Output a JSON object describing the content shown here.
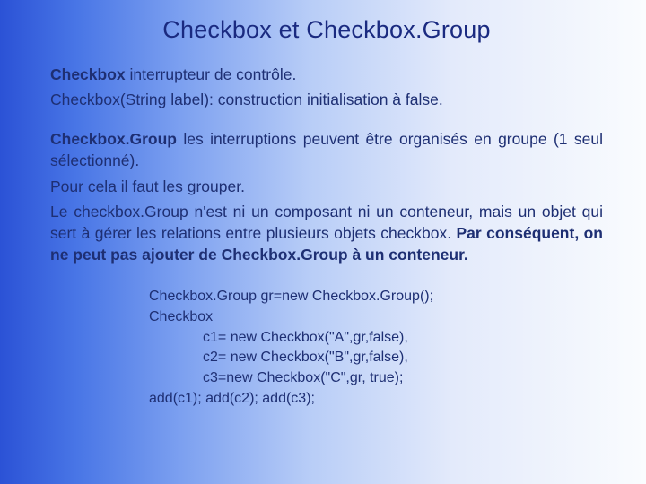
{
  "title": "Checkbox et Checkbox.Group",
  "p1_bold": "Checkbox",
  "p1_rest": " interrupteur de contrôle.",
  "p2": "Checkbox(String label): construction initialisation à false.",
  "p3_bold": "Checkbox.Group",
  "p3_rest": " les interruptions peuvent être organisés en groupe (1 seul sélectionné).",
  "p4": "Pour cela il faut les grouper.",
  "p5_a": "Le checkbox.Group n'est ni un composant ni un conteneur, mais un objet qui sert à gérer les relations entre plusieurs objets checkbox. ",
  "p5_b": "Par conséquent, on ne peut pas ajouter de Checkbox.Group à un conteneur.",
  "code": {
    "l1": "Checkbox.Group gr=new Checkbox.Group();",
    "l2": "Checkbox",
    "l3": "c1= new Checkbox(\"A\",gr,false),",
    "l4": "c2= new Checkbox(\"B\",gr,false),",
    "l5": "c3=new Checkbox(\"C\",gr, true);",
    "l6": "add(c1); add(c2); add(c3);"
  }
}
